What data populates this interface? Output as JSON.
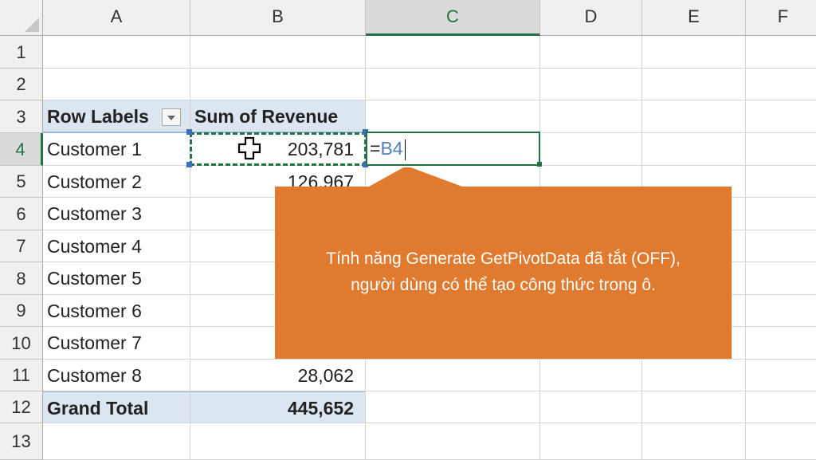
{
  "columns": [
    "A",
    "B",
    "C",
    "D",
    "E",
    "F"
  ],
  "rows": [
    "1",
    "2",
    "3",
    "4",
    "5",
    "6",
    "7",
    "8",
    "9",
    "10",
    "11",
    "12",
    "13"
  ],
  "active_column": "C",
  "active_row": "4",
  "pivot": {
    "row_labels_header": "Row Labels",
    "value_header": "Sum of Revenue",
    "items": [
      {
        "label": "Customer 1",
        "value": "203,781"
      },
      {
        "label": "Customer 2",
        "value": "126,967"
      },
      {
        "label": "Customer 3",
        "value": ""
      },
      {
        "label": "Customer 4",
        "value": ""
      },
      {
        "label": "Customer 5",
        "value": ""
      },
      {
        "label": "Customer 6",
        "value": ""
      },
      {
        "label": "Customer 7",
        "value": ""
      },
      {
        "label": "Customer 8",
        "value": "28,062"
      }
    ],
    "grand_total_label": "Grand Total",
    "grand_total_value": "445,652"
  },
  "editing_cell": {
    "prefix": "=",
    "reference": "B4"
  },
  "callout": {
    "line1": "Tính năng Generate GetPivotData đã tắt (OFF),",
    "line2": "người dùng có thể tạo công thức trong ô.",
    "color": "#e07a2e"
  },
  "colors": {
    "accent": "#217346",
    "pivot_fill": "#dce6f1",
    "reference": "#4f81bd"
  }
}
